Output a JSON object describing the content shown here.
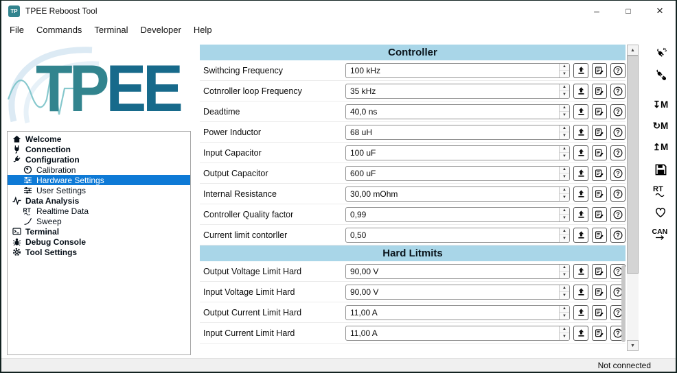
{
  "window": {
    "title": "TPEE Reboost Tool",
    "app_icon_text": "TP",
    "controls": {
      "minimize": "–",
      "maximize": "□",
      "close": "×"
    },
    "status": "Not connected"
  },
  "menu": {
    "items": [
      "File",
      "Commands",
      "Terminal",
      "Developer",
      "Help"
    ]
  },
  "logo": {
    "text": "TPEE"
  },
  "sidebar": {
    "items": [
      {
        "label": "Welcome",
        "icon": "home-icon",
        "level": 0,
        "bold": true,
        "selected": false
      },
      {
        "label": "Connection",
        "icon": "plug-icon",
        "level": 0,
        "bold": true,
        "selected": false
      },
      {
        "label": "Configuration",
        "icon": "connector-icon",
        "level": 0,
        "bold": true,
        "selected": false
      },
      {
        "label": "Calibration",
        "icon": "clock-icon",
        "level": 1,
        "bold": false,
        "selected": false
      },
      {
        "label": "Hardware Settings",
        "icon": "sliders-icon",
        "level": 1,
        "bold": false,
        "selected": true
      },
      {
        "label": "User Settings",
        "icon": "sliders-icon",
        "level": 1,
        "bold": false,
        "selected": false
      },
      {
        "label": "Data Analysis",
        "icon": "waveform-icon",
        "level": 0,
        "bold": true,
        "selected": false
      },
      {
        "label": "Realtime Data",
        "icon": "rt-icon",
        "level": 1,
        "bold": false,
        "selected": false
      },
      {
        "label": "Sweep",
        "icon": "sweep-icon",
        "level": 1,
        "bold": false,
        "selected": false
      },
      {
        "label": "Terminal",
        "icon": "terminal-icon",
        "level": 0,
        "bold": true,
        "selected": false
      },
      {
        "label": "Debug Console",
        "icon": "bug-icon",
        "level": 0,
        "bold": true,
        "selected": false
      },
      {
        "label": "Tool Settings",
        "icon": "gear-icon",
        "level": 0,
        "bold": true,
        "selected": false
      }
    ]
  },
  "form": {
    "sections": [
      {
        "title": "Controller",
        "rows": [
          {
            "label": "Swithcing Frequency",
            "value": "100 kHz"
          },
          {
            "label": "Cotnroller loop Frequency",
            "value": "35 kHz"
          },
          {
            "label": "Deadtime",
            "value": "40,0 ns"
          },
          {
            "label": "Power Inductor",
            "value": "68 uH"
          },
          {
            "label": "Input Capacitor",
            "value": "100 uF"
          },
          {
            "label": "Output Capacitor",
            "value": "600 uF"
          },
          {
            "label": "Internal Resistance",
            "value": "30,00 mOhm"
          },
          {
            "label": "Controller Quality factor",
            "value": "0,99"
          },
          {
            "label": "Current limit contorller",
            "value": "0,50"
          }
        ]
      },
      {
        "title": "Hard Litmits",
        "rows": [
          {
            "label": "Output Voltage Limit Hard",
            "value": "90,00 V"
          },
          {
            "label": "Input Voltage Limit Hard",
            "value": "90,00 V"
          },
          {
            "label": "Output Current Limit Hard",
            "value": "11,00 A"
          },
          {
            "label": "Input Current Limit Hard",
            "value": "11,00 A"
          }
        ]
      }
    ]
  },
  "spinner": {
    "up": "▲",
    "down": "▼"
  },
  "scrollbar": {
    "up": "▲",
    "down": "▼"
  },
  "right_toolbar": {
    "items": [
      {
        "name": "connect-button",
        "icon": "connect-icon"
      },
      {
        "name": "disconnect-button",
        "icon": "disconnect-icon"
      },
      {
        "name": "memory-store-button",
        "glyph": "↧M"
      },
      {
        "name": "memory-reload-button",
        "glyph": "↻M"
      },
      {
        "name": "memory-load-button",
        "glyph": "↥M"
      },
      {
        "name": "save-button",
        "icon": "save-icon"
      },
      {
        "name": "realtime-button",
        "icon": "realtime-icon"
      },
      {
        "name": "health-button",
        "icon": "heart-icon"
      },
      {
        "name": "can-button",
        "icon": "can-icon"
      }
    ]
  },
  "colors": {
    "accent": "#0e7ad6",
    "header_bg": "#a9d6e8",
    "logo_tp": "#32848e",
    "logo_ee": "#176a8b",
    "status_bg": "#f0f0f0"
  }
}
